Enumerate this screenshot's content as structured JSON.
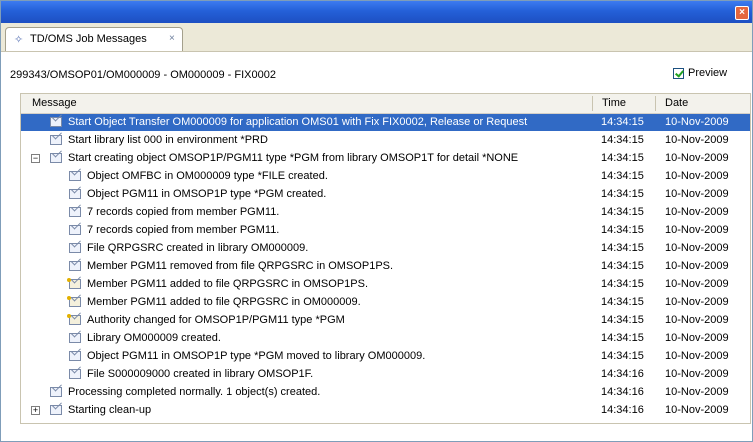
{
  "tab": {
    "label": "TD/OMS Job Messages",
    "close_glyph": "×"
  },
  "window": {
    "close_glyph": "×"
  },
  "path": "299343/OMSOP01/OM000009 - OM000009 - FIX0002",
  "preview": {
    "label": "Preview",
    "checked": true
  },
  "columns": {
    "message": "Message",
    "time": "Time",
    "date": "Date"
  },
  "rows": [
    {
      "indent": 1,
      "expander": "",
      "icon": "envelope",
      "message": "Start Object Transfer OM000009 for application OMS01 with Fix FIX0002, Release  or Request",
      "time": "14:34:15",
      "date": "10-Nov-2009",
      "selected": true
    },
    {
      "indent": 1,
      "expander": "",
      "icon": "envelope",
      "message": "Start library list 000 in environment *PRD",
      "time": "14:34:15",
      "date": "10-Nov-2009"
    },
    {
      "indent": 1,
      "expander": "−",
      "icon": "envelope",
      "message": "Start creating object OMSOP1P/PGM11 type *PGM from library OMSOP1T for detail *NONE",
      "time": "14:34:15",
      "date": "10-Nov-2009"
    },
    {
      "indent": 2,
      "expander": "",
      "icon": "envelope",
      "message": "Object OMFBC in OM000009 type *FILE created.",
      "time": "14:34:15",
      "date": "10-Nov-2009"
    },
    {
      "indent": 2,
      "expander": "",
      "icon": "envelope",
      "message": "Object PGM11 in OMSOP1P type *PGM created.",
      "time": "14:34:15",
      "date": "10-Nov-2009"
    },
    {
      "indent": 2,
      "expander": "",
      "icon": "envelope",
      "message": "7 records copied from member PGM11.",
      "time": "14:34:15",
      "date": "10-Nov-2009"
    },
    {
      "indent": 2,
      "expander": "",
      "icon": "envelope",
      "message": "7 records copied from member PGM11.",
      "time": "14:34:15",
      "date": "10-Nov-2009"
    },
    {
      "indent": 2,
      "expander": "",
      "icon": "envelope",
      "message": "File QRPGSRC created in library OM000009.",
      "time": "14:34:15",
      "date": "10-Nov-2009"
    },
    {
      "indent": 2,
      "expander": "",
      "icon": "envelope",
      "message": "Member PGM11 removed from file QRPGSRC in OMSOP1PS.",
      "time": "14:34:15",
      "date": "10-Nov-2009"
    },
    {
      "indent": 2,
      "expander": "",
      "icon": "envelope-warning",
      "message": "Member PGM11 added to file QRPGSRC in OMSOP1PS.",
      "time": "14:34:15",
      "date": "10-Nov-2009"
    },
    {
      "indent": 2,
      "expander": "",
      "icon": "envelope-warning",
      "message": "Member PGM11 added to file QRPGSRC in OM000009.",
      "time": "14:34:15",
      "date": "10-Nov-2009"
    },
    {
      "indent": 2,
      "expander": "",
      "icon": "envelope-warning",
      "message": "Authority changed for OMSOP1P/PGM11 type *PGM",
      "time": "14:34:15",
      "date": "10-Nov-2009"
    },
    {
      "indent": 2,
      "expander": "",
      "icon": "envelope",
      "message": "Library OM000009 created.",
      "time": "14:34:15",
      "date": "10-Nov-2009"
    },
    {
      "indent": 2,
      "expander": "",
      "icon": "envelope",
      "message": "Object PGM11 in OMSOP1P type *PGM moved to library OM000009.",
      "time": "14:34:15",
      "date": "10-Nov-2009"
    },
    {
      "indent": 2,
      "expander": "",
      "icon": "envelope",
      "message": "File S000009000 created in library OMSOP1F.",
      "time": "14:34:16",
      "date": "10-Nov-2009"
    },
    {
      "indent": 1,
      "expander": "",
      "icon": "envelope",
      "message": "Processing completed normally. 1 object(s) created.",
      "time": "14:34:16",
      "date": "10-Nov-2009"
    },
    {
      "indent": 1,
      "expander": "+",
      "icon": "envelope",
      "message": "Starting clean-up",
      "time": "14:34:16",
      "date": "10-Nov-2009"
    }
  ],
  "colors": {
    "titlebar": "#2460d8",
    "selection": "#316ac5",
    "panel": "#ece9d8"
  }
}
